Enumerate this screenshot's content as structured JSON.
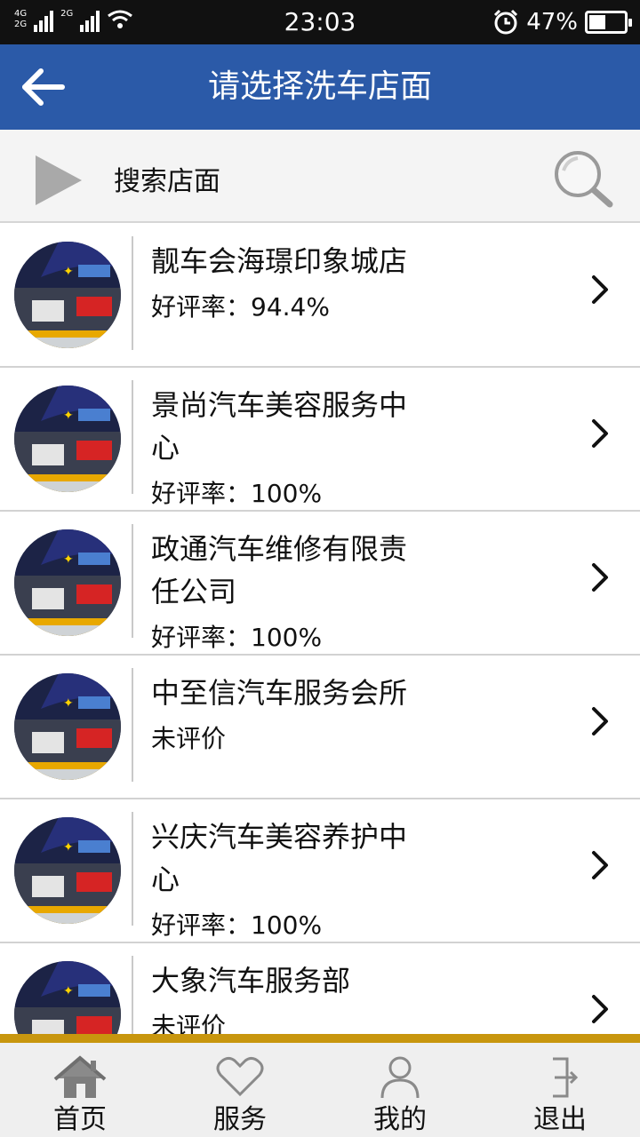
{
  "status": {
    "net_top": "4G",
    "net_bottom": "2G",
    "net_second": "2G",
    "time": "23:03",
    "battery_text": "47%",
    "battery_level": 0.47
  },
  "header": {
    "title": "请选择洗车店面"
  },
  "search": {
    "label": "搜索店面"
  },
  "stores": [
    {
      "name_line1": "靓车会海璟印象城店",
      "name_line2": "",
      "rating": "好评率：94.4%"
    },
    {
      "name_line1": "景尚汽车美容服务中",
      "name_line2": "心",
      "rating": "好评率：100%"
    },
    {
      "name_line1": "政通汽车维修有限责",
      "name_line2": "任公司",
      "rating": "好评率：100%"
    },
    {
      "name_line1": "中至信汽车服务会所",
      "name_line2": "",
      "rating": "未评价"
    },
    {
      "name_line1": "兴庆汽车美容养护中",
      "name_line2": "心",
      "rating": "好评率：100%"
    },
    {
      "name_line1": "大象汽车服务部",
      "name_line2": "",
      "rating": "未评价"
    }
  ],
  "nav": {
    "home": "首页",
    "service": "服务",
    "mine": "我的",
    "logout": "退出"
  },
  "colors": {
    "header": "#2b5aa8",
    "accent_gold": "#c8960e",
    "nav_bg": "#efefef"
  }
}
